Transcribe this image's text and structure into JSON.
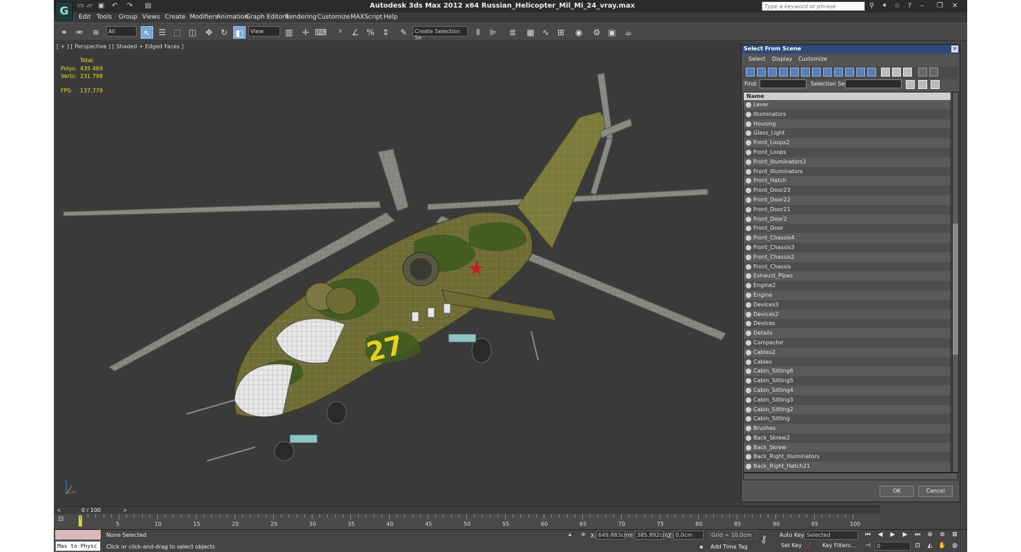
{
  "app": {
    "logo": "G",
    "title": "Autodesk 3ds Max  2012 x64     Russian_Helicopter_Mil_Mi_24_vray.max",
    "search_placeholder": "Type a keyword or phrase"
  },
  "menus": [
    "Edit",
    "Tools",
    "Group",
    "Views",
    "Create",
    "Modifiers",
    "Animation",
    "Graph Editors",
    "Rendering",
    "Customize",
    "MAXScript",
    "Help"
  ],
  "toolbar": {
    "filter_value": "All",
    "ref_coord_value": "View",
    "selection_set_placeholder": "Create Selection Se"
  },
  "viewport": {
    "label": "[ + ] [ Perspective ] [ Shaded + Edged Faces ]",
    "stats_total": "Total",
    "polys_label": "Polys:",
    "polys_value": "435 469",
    "verts_label": "Verts:",
    "verts_value": "231 798",
    "fps_label": "FPS:",
    "fps_value": "137,779",
    "nose_number": "27"
  },
  "dialog": {
    "title": "Select From Scene",
    "menu": [
      "Select",
      "Display",
      "Customize"
    ],
    "find_label": "Find:",
    "selection_set_label": "Selection Set:",
    "column_name": "Name",
    "items": [
      "Lever",
      "Illuminators",
      "Housing",
      "Glass_Light",
      "Front_Loops2",
      "Front_Loops",
      "Front_Illuminators2",
      "Front_Illuminators",
      "Front_Hatch",
      "Front_Door23",
      "Front_Door22",
      "Front_Door21",
      "Front_Door2",
      "Front_Door",
      "Front_Chassis4",
      "Front_Chassis3",
      "Front_Chassis2",
      "Front_Chassis",
      "Exhaust_Pipes",
      "Engine2",
      "Engine",
      "Devices3",
      "Devices2",
      "Devices",
      "Details",
      "Compactor",
      "Cables2",
      "Cables",
      "Cabin_Sitting6",
      "Cabin_Sitting5",
      "Cabin_Sitting4",
      "Cabin_Sitting3",
      "Cabin_Sitting2",
      "Cabin_Sitting",
      "Brushes",
      "Back_Skrew2",
      "Back_Skrew",
      "Back_Right_Illuminators",
      "Back_Right_Hatch21"
    ],
    "ok_label": "OK",
    "cancel_label": "Cancel"
  },
  "timeline": {
    "position_label": "0 / 100",
    "ticks": [
      "5",
      "10",
      "15",
      "20",
      "25",
      "30",
      "35",
      "40",
      "45",
      "50",
      "55",
      "60",
      "65",
      "70",
      "75",
      "80",
      "85",
      "90",
      "95",
      "100"
    ]
  },
  "status": {
    "selection": "None Selected",
    "prompt": "Click or click-and-drag to select objects",
    "maxscript": "Max to Physc",
    "x_label": "X:",
    "x_value": "649,883cm",
    "y_label": "Y:",
    "y_value": "385,892cm",
    "z_label": "Z:",
    "z_value": "0,0cm",
    "grid": "Grid = 10,0cm",
    "add_time_tag": "Add Time Tag",
    "auto_key": "Auto Key",
    "set_key": "Set Key",
    "key_mode_value": "Selected",
    "key_filters": "Key Filters...",
    "frame_value": "0"
  },
  "colors": {
    "accent": "#2e4a7a",
    "camo_olive": "#6b6a2e",
    "camo_green": "#3f5a1f",
    "number_yellow": "#e8d020",
    "star_red": "#c02020"
  }
}
